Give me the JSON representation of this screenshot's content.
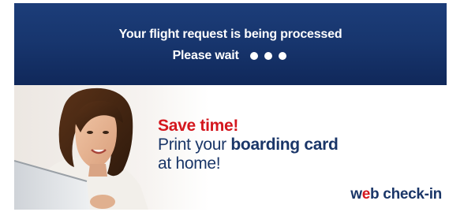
{
  "header": {
    "processing_text": "Your flight request is being processed",
    "wait_text": "Please wait",
    "progress_dot_count": 3,
    "background": "#17356d"
  },
  "promo": {
    "headline": "Save time!",
    "line2_prefix": "Print your ",
    "line2_emphasis": "boarding card",
    "line3": "at home!",
    "headline_color": "#d4171e",
    "text_color": "#1a3668"
  },
  "brand": {
    "prefix": "w",
    "accent": "e",
    "suffix": "b check-in"
  }
}
